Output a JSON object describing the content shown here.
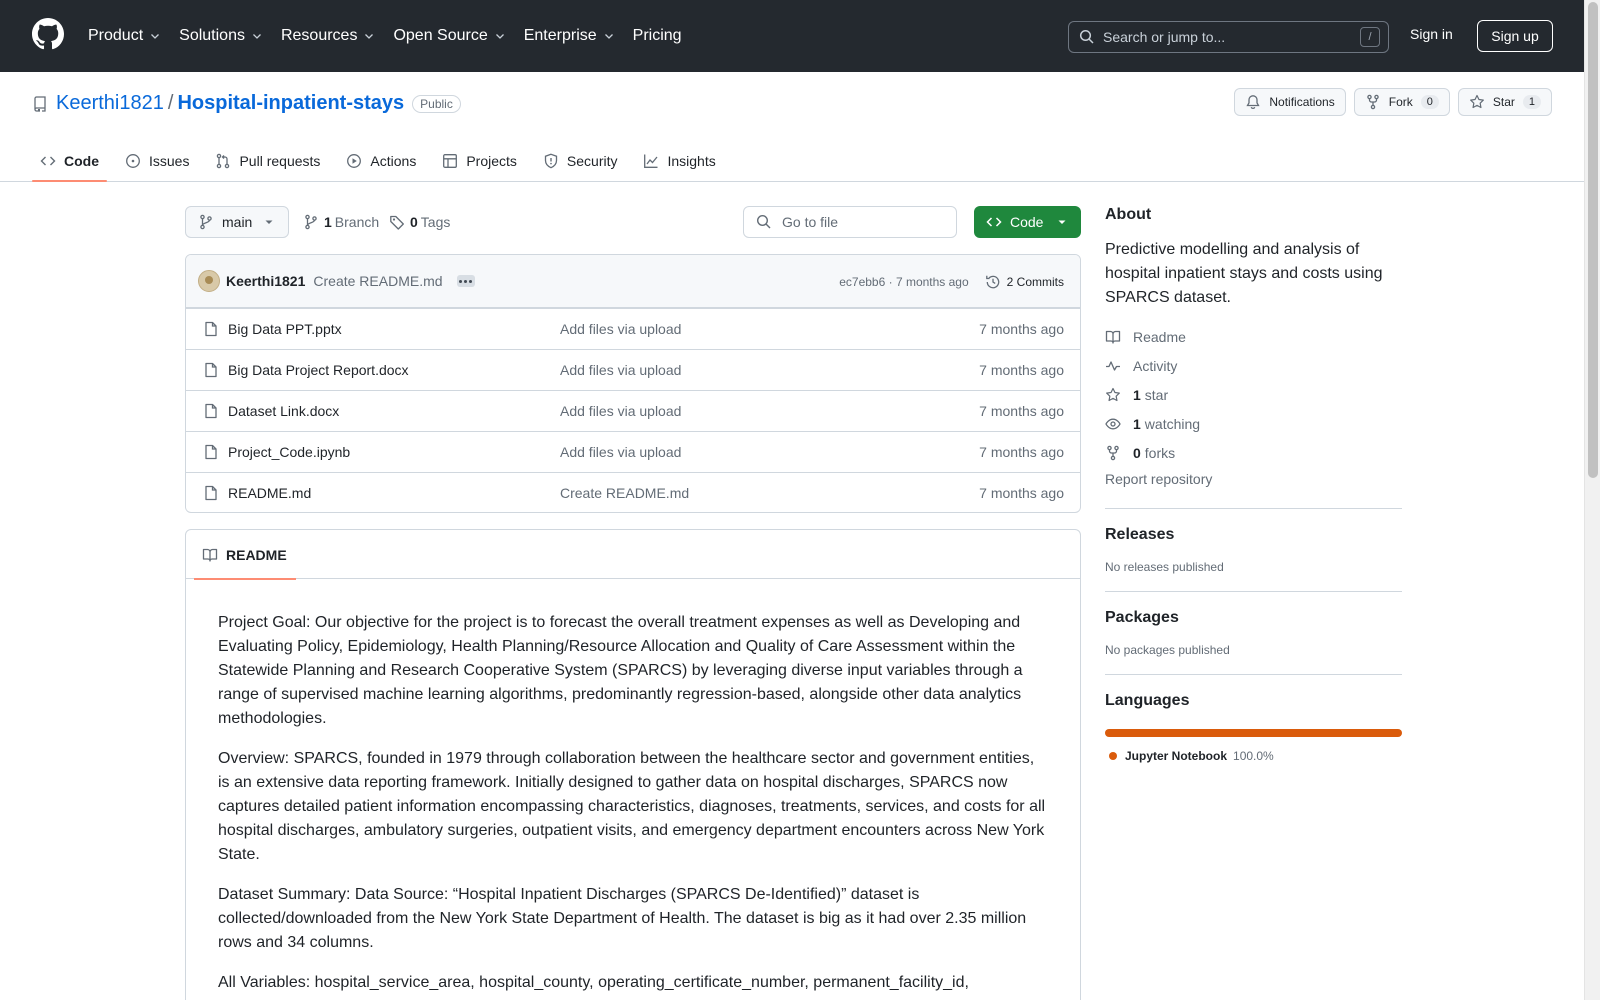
{
  "colors": {
    "header_bg": "#24292f",
    "link": "#0969da",
    "primary_button": "#1f883d",
    "active_tab_underline": "#fd8c73",
    "language": "#da5b0b"
  },
  "topnav": {
    "items": [
      {
        "label": "Product",
        "dropdown": true
      },
      {
        "label": "Solutions",
        "dropdown": true
      },
      {
        "label": "Resources",
        "dropdown": true
      },
      {
        "label": "Open Source",
        "dropdown": true
      },
      {
        "label": "Enterprise",
        "dropdown": true
      },
      {
        "label": "Pricing",
        "dropdown": false
      }
    ],
    "search_placeholder": "Search or jump to...",
    "search_shortcut": "/",
    "sign_in": "Sign in",
    "sign_up": "Sign up"
  },
  "repo": {
    "owner": "Keerthi1821",
    "separator": "/",
    "name": "Hospital-inpatient-stays",
    "visibility": "Public",
    "actions": {
      "notifications_label": "Notifications",
      "fork_label": "Fork",
      "fork_count": "0",
      "star_label": "Star",
      "star_count": "1"
    },
    "tabs": [
      {
        "label": "Code",
        "icon": "code-icon",
        "active": true
      },
      {
        "label": "Issues",
        "icon": "issue-icon",
        "active": false
      },
      {
        "label": "Pull requests",
        "icon": "pull-request-icon",
        "active": false
      },
      {
        "label": "Actions",
        "icon": "play-icon",
        "active": false
      },
      {
        "label": "Projects",
        "icon": "table-icon",
        "active": false
      },
      {
        "label": "Security",
        "icon": "shield-icon",
        "active": false
      },
      {
        "label": "Insights",
        "icon": "graph-icon",
        "active": false
      }
    ]
  },
  "file_nav": {
    "branch": "main",
    "branch_count": "1",
    "branch_label": "Branch",
    "tag_count": "0",
    "tag_label": "Tags",
    "goto_placeholder": "Go to file",
    "code_button": "Code"
  },
  "latest_commit": {
    "author": "Keerthi1821",
    "message": "Create README.md",
    "hash_time": "ec7ebb6 · 7 months ago",
    "commits_label": "2 Commits"
  },
  "files": [
    {
      "name": "Big Data PPT.pptx",
      "message": "Add files via upload",
      "date": "7 months ago"
    },
    {
      "name": "Big Data Project Report.docx",
      "message": "Add files via upload",
      "date": "7 months ago"
    },
    {
      "name": "Dataset Link.docx",
      "message": "Add files via upload",
      "date": "7 months ago"
    },
    {
      "name": "Project_Code.ipynb",
      "message": "Add files via upload",
      "date": "7 months ago"
    },
    {
      "name": "README.md",
      "message": "Create README.md",
      "date": "7 months ago"
    }
  ],
  "readme": {
    "tab_label": "README",
    "paragraphs": [
      "Project Goal: Our objective for the project is to forecast the overall treatment expenses as well as Developing and Evaluating Policy, Epidemiology, Health Planning/Resource Allocation and Quality of Care Assessment within the Statewide Planning and Research Cooperative System (SPARCS) by leveraging diverse input variables through a range of supervised machine learning algorithms, predominantly regression-based, alongside other data analytics methodologies.",
      "Overview: SPARCS, founded in 1979 through collaboration between the healthcare sector and government entities, is an extensive data reporting framework. Initially designed to gather data on hospital discharges, SPARCS now captures detailed patient information encompassing characteristics, diagnoses, treatments, services, and costs for all hospital discharges, ambulatory surgeries, outpatient visits, and emergency department encounters across New York State.",
      "Dataset Summary: Data Source: “Hospital Inpatient Discharges (SPARCS De-Identified)” dataset is collected/downloaded from the New York State Department of Health. The dataset is big as it had over 2.35 million rows and 34 columns.",
      "All Variables: hospital_service_area, hospital_county, operating_certificate_number, permanent_facility_id,"
    ]
  },
  "sidebar": {
    "about_title": "About",
    "description": "Predictive modelling and analysis of hospital inpatient stays and costs using SPARCS dataset.",
    "readme_link": "Readme",
    "activity_link": "Activity",
    "stars_count": "1",
    "stars_label": "star",
    "watching_count": "1",
    "watching_label": "watching",
    "forks_count": "0",
    "forks_label": "forks",
    "report": "Report repository",
    "releases_title": "Releases",
    "releases_empty": "No releases published",
    "packages_title": "Packages",
    "packages_empty": "No packages published",
    "languages_title": "Languages",
    "language_name": "Jupyter Notebook",
    "language_percent": "100.0%"
  }
}
